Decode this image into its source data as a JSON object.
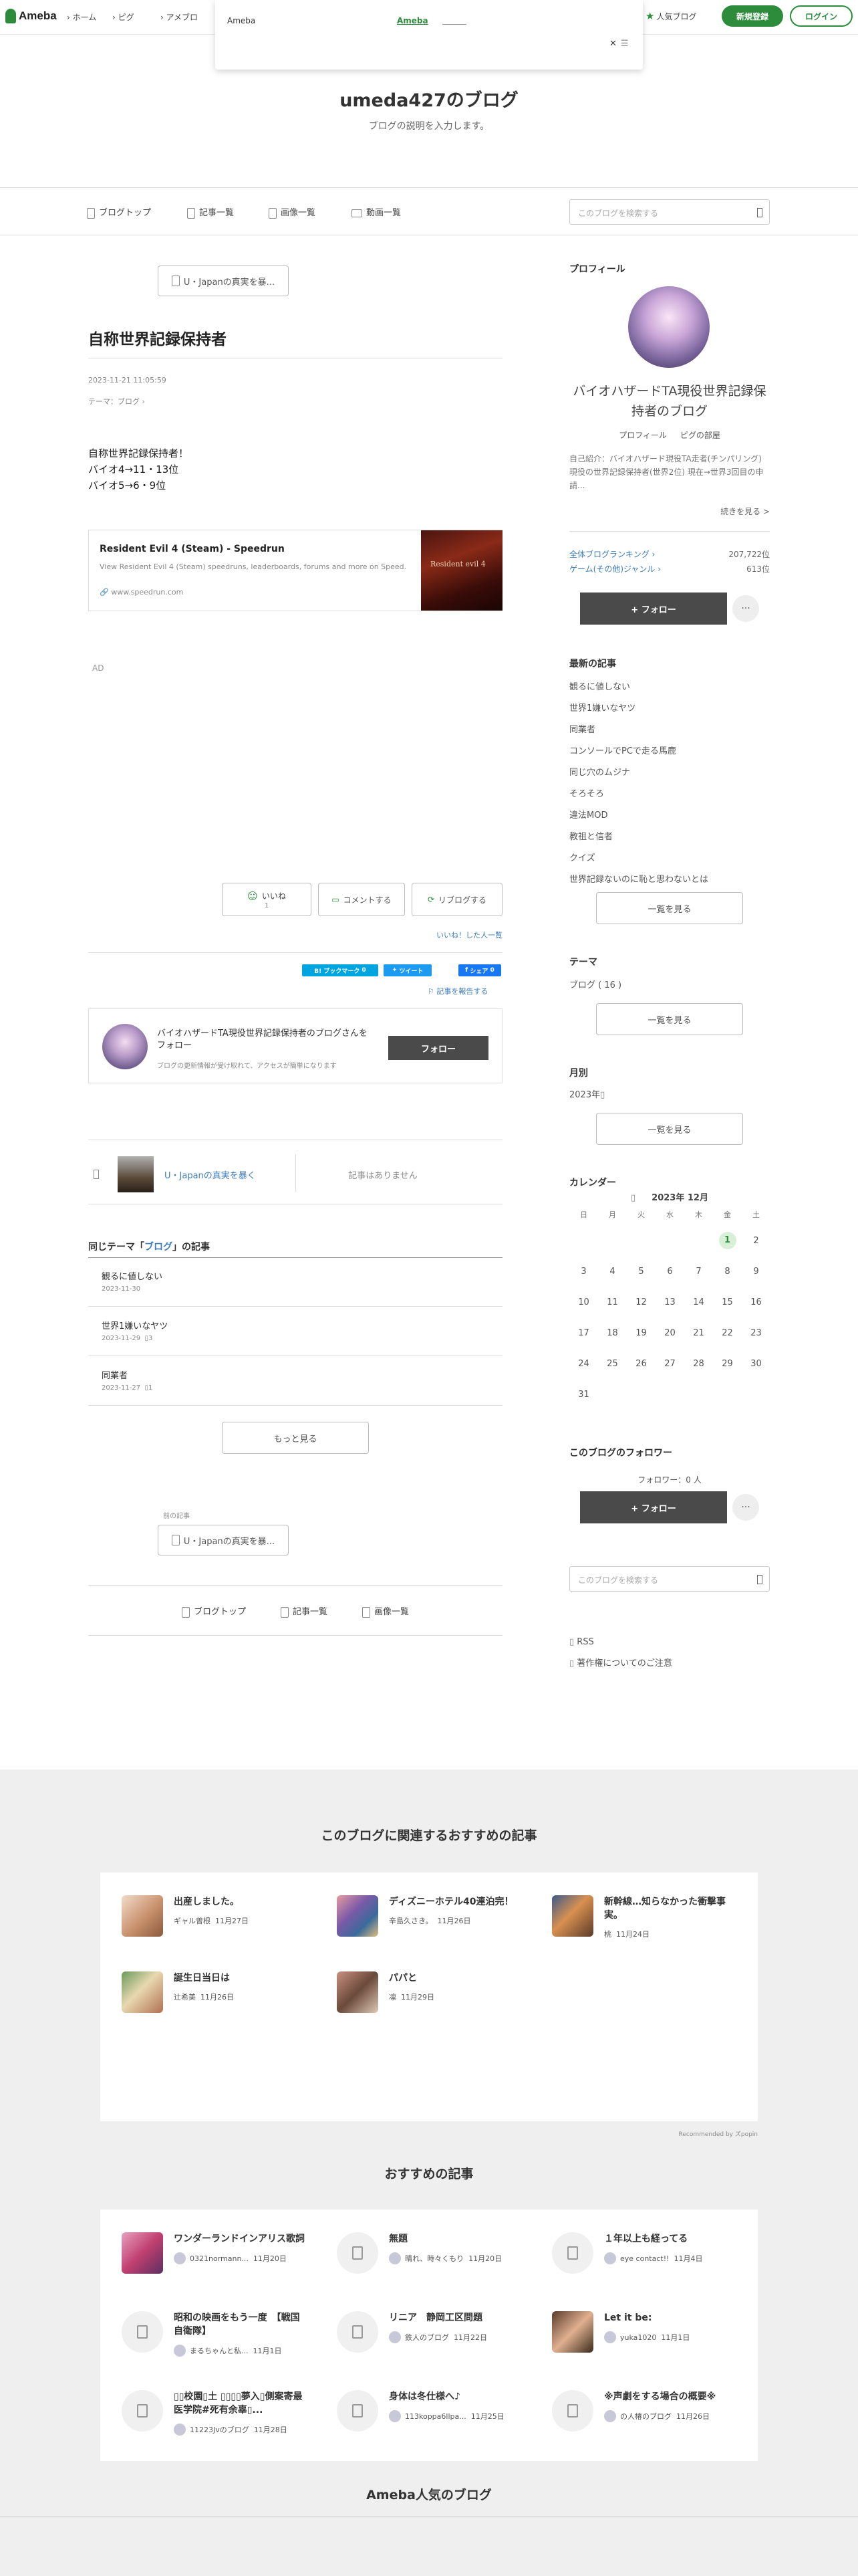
{
  "header": {
    "logo": "Ameba",
    "nav": [
      "ホーム",
      "ピグ",
      "アメブロ"
    ],
    "popular": "人気ブログ",
    "signup": "新規登録",
    "login": "ログイン",
    "popup": {
      "left": "Ameba",
      "link": "Ameba",
      "close": "✕"
    }
  },
  "blog": {
    "title": "umeda427のブログ",
    "description": "ブログの説明を入力します。",
    "nav": [
      "ブログトップ",
      "記事一覧",
      "画像一覧",
      "動画一覧"
    ],
    "search_placeholder": "このブログを検索する"
  },
  "article": {
    "prev_btn": "U・Japanの真実を暴...",
    "title": "自称世界記録保持者",
    "date": "2023-11-21 11:05:59",
    "theme": "テーマ：ブログ",
    "body": [
      "自称世界記録保持者！",
      "バイオ4→11・13位",
      "バイオ5→6・9位"
    ],
    "card": {
      "title": "Resident Evil 4 (Steam) - Speedrun",
      "desc": "View Resident Evil 4 (Steam) speedruns, leaderboards, forums and more on Speed...",
      "url": "www.speedrun.com",
      "thumb_text": "Resident evil 4"
    },
    "ad": "AD",
    "actions": {
      "like": "いいね",
      "like_count": "1",
      "comment": "コメントする",
      "reblog": "リブログする"
    },
    "liked_list": "いいね！した人一覧",
    "share": {
      "bookmark": "B! ブックマーク",
      "bookmark_count": "0",
      "tweet": "ツイート",
      "fb": "シェア",
      "fb_count": "0"
    },
    "report": "記事を報告する",
    "follow_box": {
      "title": "バイオハザードTA現役世界記録保持者のブログさんをフォロー",
      "desc": "ブログの更新情報が受け取れて、アクセスが簡単になります",
      "button": "フォロー"
    },
    "pager": {
      "prev": "U・Japanの真実を暴く",
      "next": "記事はありません"
    },
    "same_theme": {
      "prefix": "同じテーマ「",
      "theme": "ブログ",
      "suffix": "」の記事",
      "items": [
        {
          "title": "観るに値しない",
          "date": "2023-11-30",
          "comments": ""
        },
        {
          "title": "世界1嫌いなヤツ",
          "date": "2023-11-29",
          "comments": "3"
        },
        {
          "title": "同業者",
          "date": "2023-11-27",
          "comments": "1"
        }
      ],
      "more": "もっと見る"
    },
    "prev_label": "前の記事",
    "prev_btn2": "U・Japanの真実を暴...",
    "bottom_nav": [
      "ブログトップ",
      "記事一覧",
      "画像一覧"
    ]
  },
  "sidebar": {
    "profile": {
      "heading": "プロフィール",
      "name": "バイオハザードTA現役世界記録保持者のブログ",
      "links": [
        "プロフィール",
        "ピグの部屋"
      ],
      "intro": "自己紹介：バイオハザード現役TA走者(チンパリング) 現役の世界記録保持者(世界2位) 現在→世界3回目の申請...",
      "more": "続きを見る >",
      "rank1_label": "全体ブログランキング",
      "rank1_value": "207,722位",
      "rank2_label": "ゲーム(その他)ジャンル",
      "rank2_value": "613位",
      "follow": "+ フォロー",
      "dots": "···"
    },
    "latest": {
      "heading": "最新の記事",
      "items": [
        "観るに値しない",
        "世界1嫌いなヤツ",
        "同業者",
        "コンソールでPCで走る馬鹿",
        "同じ穴のムジナ",
        "そろそろ",
        "違法MOD",
        "教祖と信者",
        "クイズ",
        "世界記録ないのに恥と思わないとは"
      ],
      "more": "一覧を見る"
    },
    "theme": {
      "heading": "テーマ",
      "item": "ブログ ( 16 )",
      "more": "一覧を見る"
    },
    "monthly": {
      "heading": "月別",
      "item": "2023年",
      "more": "一覧を見る"
    },
    "calendar": {
      "heading": "カレンダー",
      "month": "2023年 12月",
      "dows": [
        "日",
        "月",
        "火",
        "水",
        "木",
        "金",
        "土"
      ],
      "weeks": [
        [
          "",
          "",
          "",
          "",
          "",
          "1",
          "2"
        ],
        [
          "3",
          "4",
          "5",
          "6",
          "7",
          "8",
          "9"
        ],
        [
          "10",
          "11",
          "12",
          "13",
          "14",
          "15",
          "16"
        ],
        [
          "17",
          "18",
          "19",
          "20",
          "21",
          "22",
          "23"
        ],
        [
          "24",
          "25",
          "26",
          "27",
          "28",
          "29",
          "30"
        ],
        [
          "31",
          "",
          "",
          "",
          "",
          "",
          ""
        ]
      ],
      "today": "1"
    },
    "followers": {
      "heading": "このブログのフォロワー",
      "count": "フォロワー：0 人",
      "follow": "+ フォロー",
      "dots": "···"
    },
    "search_placeholder": "このブログを検索する",
    "rss": "RSS",
    "copyright": "著作権についてのご注意"
  },
  "related": {
    "heading": "このブログに関連するおすすめの記事",
    "items": [
      {
        "title": "出産しました。",
        "author": "ギャル曽根",
        "date": "11月27日"
      },
      {
        "title": "ディズニーホテル40連泊完！",
        "author": "辛島久さき。",
        "date": "11月26日"
      },
      {
        "title": "新幹線…知らなかった衝撃事実。",
        "author": "桃",
        "date": "11月24日"
      },
      {
        "title": "誕生日当日は",
        "author": "辻希美",
        "date": "11月26日"
      },
      {
        "title": "パパと",
        "author": "凛",
        "date": "11月29日"
      }
    ],
    "recommended_by": "Recommended by ズpopin"
  },
  "recommend": {
    "heading": "おすすめの記事",
    "items": [
      {
        "title": "ワンダーランドインアリス歌詞",
        "author": "0321normann...",
        "date": "11月20日"
      },
      {
        "title": "無題",
        "author": "晴れ、時々くもり",
        "date": "11月20日"
      },
      {
        "title": "１年以上も経ってる",
        "author": "eye contact!!",
        "date": "11月4日"
      },
      {
        "title": "昭和の映画をもう一度　【戦国自衛隊】",
        "author": "まるちゃんと私...",
        "date": "11月1日"
      },
      {
        "title": "リニア　静岡工区問題",
        "author": "鉄人のブログ",
        "date": "11月22日"
      },
      {
        "title": "Let it be:",
        "author": "yuka1020",
        "date": "11月1日"
      },
      {
        "title": "▯▯校園▯土 ▯▯▯▯夢入▯側案寄最医学院#死有余辜▯...",
        "author": "11223Jvのブログ",
        "date": "11月28日"
      },
      {
        "title": "身体は冬仕様へ♪",
        "author": "113koppa6llpa...",
        "date": "11月25日"
      },
      {
        "title": "※声劇をする場合の概要※",
        "author": "の人椿のブログ",
        "date": "11月26日"
      }
    ]
  },
  "popular_footer": {
    "heading": "Ameba人気のブログ"
  },
  "colors": {
    "green": "#2d8c3c",
    "link_blue": "#3f7cb8",
    "dark_btn": "#4a4a4a"
  }
}
